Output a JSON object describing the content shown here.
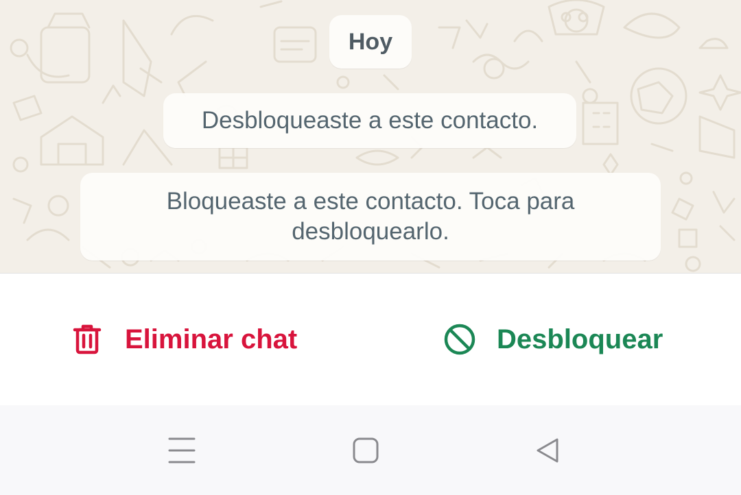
{
  "chat": {
    "date_label": "Hoy",
    "system_messages": [
      "Desbloqueaste a este contacto.",
      "Bloqueaste a este contacto. Toca para desbloquearlo."
    ]
  },
  "actions": {
    "delete_chat_label": "Eliminar chat",
    "delete_chat_icon": "trash-icon",
    "unblock_label": "Desbloquear",
    "unblock_icon": "block-icon"
  },
  "nav_bar": {
    "items": [
      "menu-icon",
      "home-icon",
      "back-icon"
    ]
  },
  "colors": {
    "wallpaper": "#f3efe8",
    "system_text": "#54656f",
    "delete_red": "#d8143c",
    "unblock_green": "#1b8755",
    "nav_icon_gray": "#8a8a8e"
  }
}
